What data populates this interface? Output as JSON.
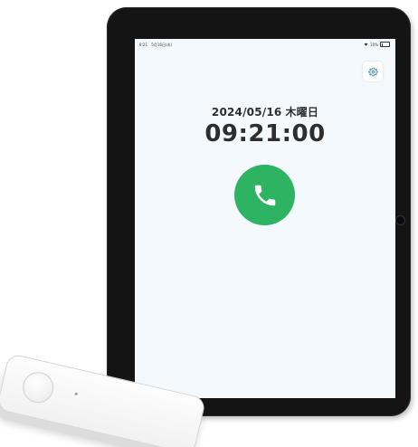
{
  "status_bar": {
    "time": "9:21",
    "date": "5月16日(木)",
    "battery_text": "10%",
    "battery_level": 0.1
  },
  "main": {
    "date": "2024/05/16",
    "weekday": "木曜日",
    "time": "09:21:00"
  },
  "icons": {
    "settings": "gear-icon",
    "call": "phone-icon",
    "wifi": "wifi-icon",
    "battery": "battery-icon"
  },
  "colors": {
    "call_green": "#2db362",
    "screen_bg": "#f3f9fd",
    "text_dark": "#2e2e2e",
    "bezel": "#141414"
  }
}
